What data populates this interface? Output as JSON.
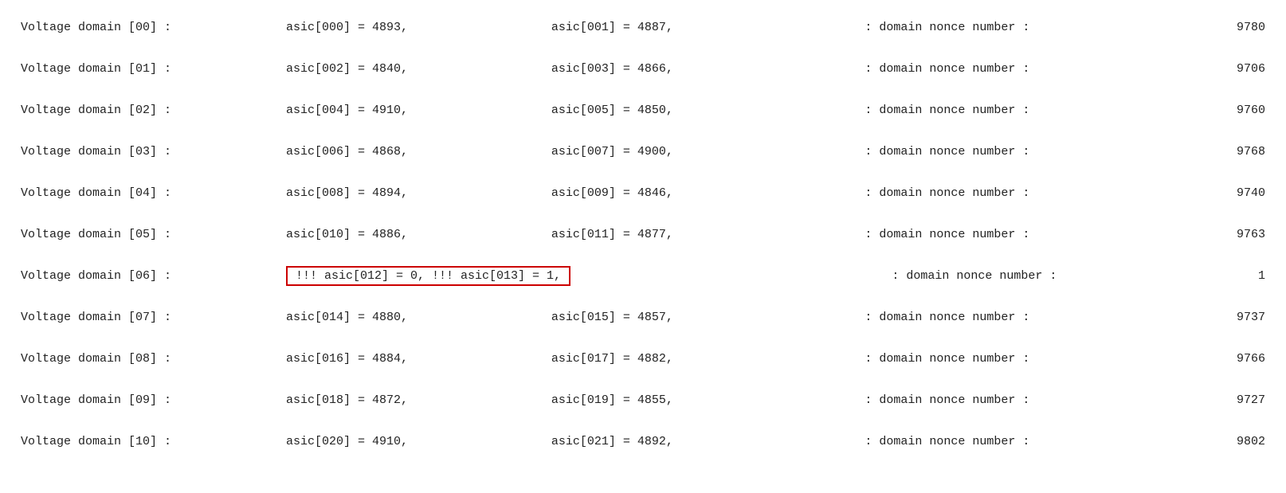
{
  "rows": [
    {
      "domain": "Voltage domain [00] :",
      "asic1_label": "asic[000]",
      "asic1_value": "4893",
      "asic1_prefix": "",
      "asic2_label": "asic[001]",
      "asic2_value": "4887",
      "asic2_prefix": "",
      "nonce_label": ": domain nonce number :",
      "nonce_value": "9780",
      "highlight": false
    },
    {
      "domain": "Voltage domain [01] :",
      "asic1_label": "asic[002]",
      "asic1_value": "4840",
      "asic1_prefix": "",
      "asic2_label": "asic[003]",
      "asic2_value": "4866",
      "asic2_prefix": "",
      "nonce_label": ": domain nonce number :",
      "nonce_value": "9706",
      "highlight": false
    },
    {
      "domain": "Voltage domain [02] :",
      "asic1_label": "asic[004]",
      "asic1_value": "4910",
      "asic1_prefix": "",
      "asic2_label": "asic[005]",
      "asic2_value": "4850",
      "asic2_prefix": "",
      "nonce_label": ": domain nonce number :",
      "nonce_value": "9760",
      "highlight": false
    },
    {
      "domain": "Voltage domain [03] :",
      "asic1_label": "asic[006]",
      "asic1_value": "4868",
      "asic1_prefix": "",
      "asic2_label": "asic[007]",
      "asic2_value": "4900",
      "asic2_prefix": "",
      "nonce_label": ": domain nonce number :",
      "nonce_value": "9768",
      "highlight": false
    },
    {
      "domain": "Voltage domain [04] :",
      "asic1_label": "asic[008]",
      "asic1_value": "4894",
      "asic1_prefix": "",
      "asic2_label": "asic[009]",
      "asic2_value": "4846",
      "asic2_prefix": "",
      "nonce_label": ": domain nonce number :",
      "nonce_value": "9740",
      "highlight": false
    },
    {
      "domain": "Voltage domain [05] :",
      "asic1_label": "asic[010]",
      "asic1_value": "4886",
      "asic1_prefix": "",
      "asic2_label": "asic[011]",
      "asic2_value": "4877",
      "asic2_prefix": "",
      "nonce_label": ": domain nonce number :",
      "nonce_value": "9763",
      "highlight": false
    },
    {
      "domain": "Voltage domain [06] :",
      "asic1_label": "asic[012]",
      "asic1_value": "0",
      "asic1_prefix": "!!! ",
      "asic2_label": "asic[013]",
      "asic2_value": "1",
      "asic2_prefix": "!!! ",
      "nonce_label": ": domain nonce number :",
      "nonce_value": "1",
      "highlight": true
    },
    {
      "domain": "Voltage domain [07] :",
      "asic1_label": "asic[014]",
      "asic1_value": "4880",
      "asic1_prefix": "",
      "asic2_label": "asic[015]",
      "asic2_value": "4857",
      "asic2_prefix": "",
      "nonce_label": ": domain nonce number :",
      "nonce_value": "9737",
      "highlight": false
    },
    {
      "domain": "Voltage domain [08] :",
      "asic1_label": "asic[016]",
      "asic1_value": "4884",
      "asic1_prefix": "",
      "asic2_label": "asic[017]",
      "asic2_value": "4882",
      "asic2_prefix": "",
      "nonce_label": ": domain nonce number :",
      "nonce_value": "9766",
      "highlight": false
    },
    {
      "domain": "Voltage domain [09] :",
      "asic1_label": "asic[018]",
      "asic1_value": "4872",
      "asic1_prefix": "",
      "asic2_label": "asic[019]",
      "asic2_value": "4855",
      "asic2_prefix": "",
      "nonce_label": ": domain nonce number :",
      "nonce_value": "9727",
      "highlight": false
    },
    {
      "domain": "Voltage domain [10] :",
      "asic1_label": "asic[020]",
      "asic1_value": "4910",
      "asic1_prefix": "",
      "asic2_label": "asic[021]",
      "asic2_value": "4892",
      "asic2_prefix": "",
      "nonce_label": ": domain nonce number :",
      "nonce_value": "9802",
      "highlight": false
    }
  ]
}
